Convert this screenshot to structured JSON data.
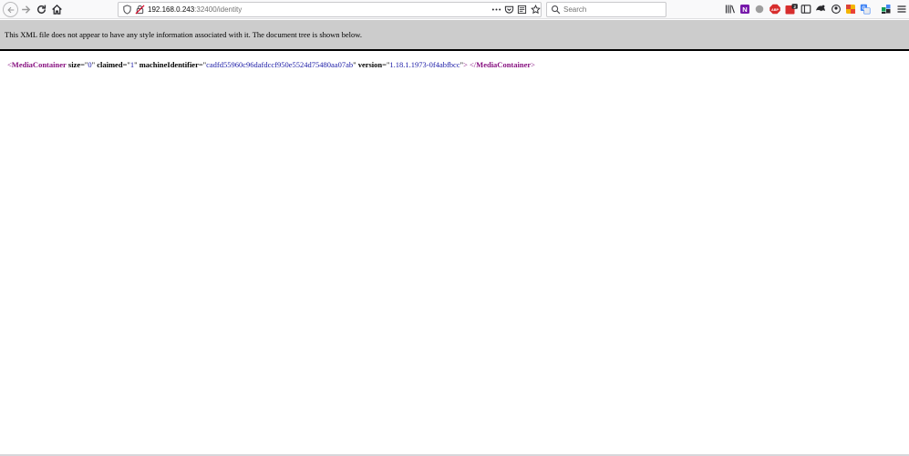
{
  "browser": {
    "url": {
      "host": "192.168.0.243",
      "rest": ":32400/identity"
    },
    "search": {
      "placeholder": "Search"
    },
    "colors": {
      "toolbar_bg": "#f9f9fa",
      "banner_bg": "#cccccc",
      "tag": "#881280",
      "attr_value": "#1a1aa6"
    },
    "extensions": {
      "adblock_label": "ABP",
      "notification_badge": "2"
    }
  },
  "xml_banner": {
    "message": "This XML file does not appear to have any style information associated with it. The document tree is shown below."
  },
  "xml_document": {
    "open_tag": "MediaContainer",
    "attributes": [
      {
        "name": "size",
        "value": "0"
      },
      {
        "name": "claimed",
        "value": "1"
      },
      {
        "name": "machineIdentifier",
        "value": "cadfd55960c96dafdccf950e5524d75480aa07ab"
      },
      {
        "name": "version",
        "value": "1.18.1.1973-0f4abfbcc"
      }
    ],
    "close_tag": "MediaContainer"
  }
}
